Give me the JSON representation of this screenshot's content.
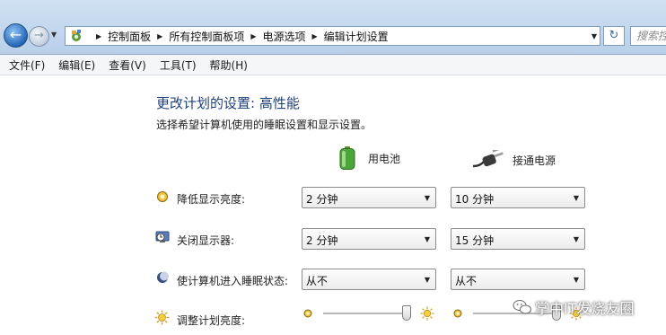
{
  "address_bar": {
    "breadcrumbs": [
      "控制面板",
      "所有控制面板项",
      "电源选项",
      "编辑计划设置"
    ],
    "search_placeholder": "搜索控制"
  },
  "menu": [
    "文件(F)",
    "编辑(E)",
    "查看(V)",
    "工具(T)",
    "帮助(H)"
  ],
  "plan": {
    "title": "更改计划的设置: 高性能",
    "subtitle": "选择希望计算机使用的睡眠设置和显示设置。"
  },
  "columns": {
    "battery": "用电池",
    "plugged_in": "接通电源"
  },
  "settings": [
    {
      "label": "降低显示亮度:",
      "icon": "dim-display-icon",
      "battery": "2 分钟",
      "plugged": "10 分钟"
    },
    {
      "label": "关闭显示器:",
      "icon": "display-off-icon",
      "battery": "2 分钟",
      "plugged": "15 分钟"
    },
    {
      "label": "使计算机进入睡眠状态:",
      "icon": "sleep-moon-icon",
      "battery": "从不",
      "plugged": "从不"
    }
  ],
  "brightness": {
    "label": "调整计划亮度:",
    "battery_level": 0.95,
    "plugged_level": 0.95
  },
  "watermark": "掌中IT发烧友圈"
}
